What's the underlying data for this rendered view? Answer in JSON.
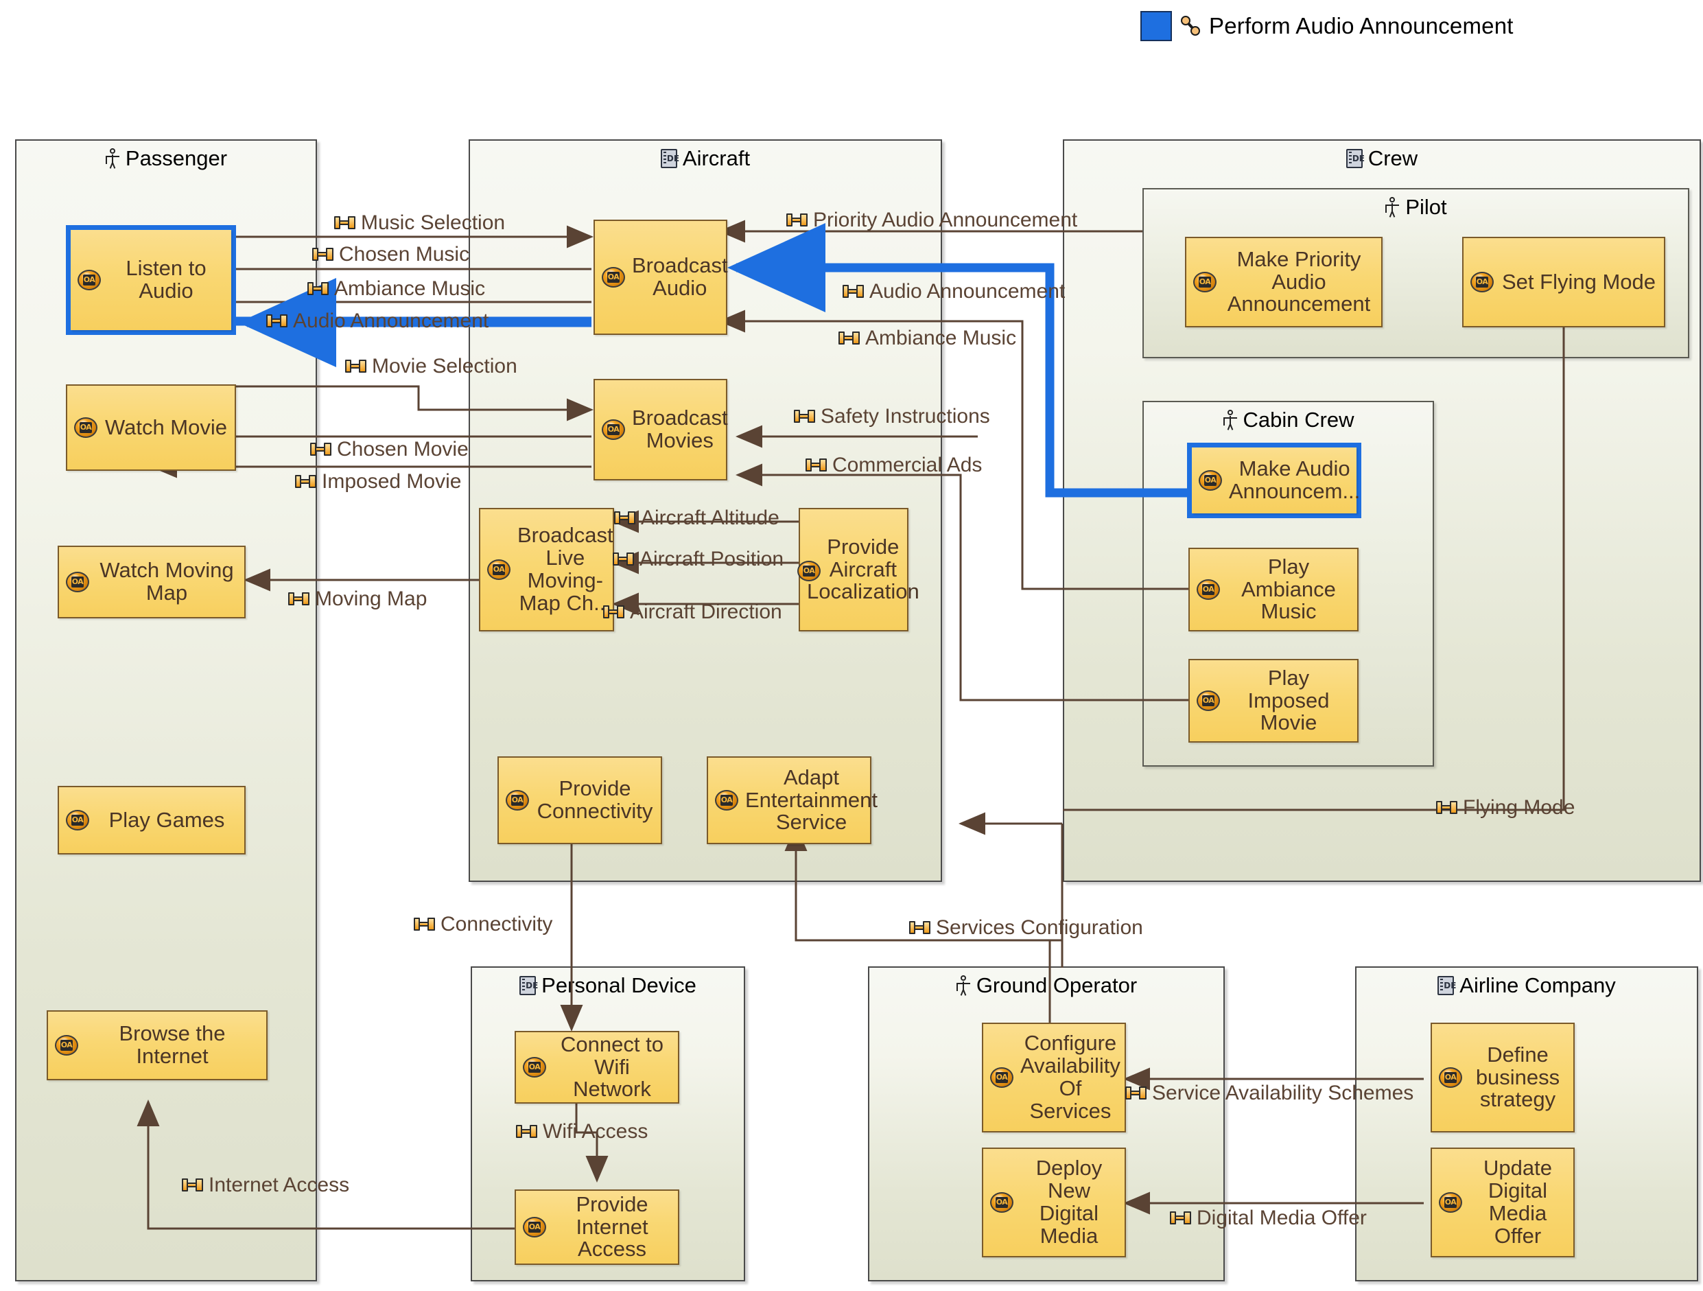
{
  "legend": {
    "label": "Perform Audio Announcement",
    "swatch_color": "#1E6FE0",
    "icon": "chain-link-icon"
  },
  "colors": {
    "highlight": "#1E6FE0",
    "activity_fill": "#F9D772",
    "activity_border": "#7a5a2a",
    "container_top": "#F7F8F3",
    "container_bottom": "#DEE0CC",
    "connector": "#5a4334",
    "text": "#4a3526"
  },
  "containers": [
    {
      "id": "passenger",
      "title": "Passenger",
      "icon": "actor-icon"
    },
    {
      "id": "aircraft",
      "title": "Aircraft",
      "icon": "block-icon"
    },
    {
      "id": "crew",
      "title": "Crew",
      "icon": "block-icon"
    },
    {
      "id": "pilot",
      "title": "Pilot",
      "icon": "actor-icon"
    },
    {
      "id": "cabin_crew",
      "title": "Cabin Crew",
      "icon": "actor-icon"
    },
    {
      "id": "personal_device",
      "title": "Personal Device",
      "icon": "block-icon"
    },
    {
      "id": "ground_operator",
      "title": "Ground Operator",
      "icon": "actor-icon"
    },
    {
      "id": "airline_company",
      "title": "Airline Company",
      "icon": "block-icon"
    }
  ],
  "activities": {
    "listen_to_audio": "Listen to Audio",
    "watch_movie": "Watch Movie",
    "watch_moving_map": "Watch Moving Map",
    "play_games": "Play Games",
    "browse_the_internet": "Browse the Internet",
    "broadcast_audio": "Broadcast Audio",
    "broadcast_movies": "Broadcast Movies",
    "broadcast_live_map": "Broadcast Live Moving-Map Ch...",
    "provide_aircraft_loc": "Provide Aircraft Localization",
    "provide_connectivity": "Provide Connectivity",
    "adapt_entertainment": "Adapt Entertainment Service",
    "make_priority_audio": "Make Priority Audio Announcement",
    "set_flying_mode": "Set Flying Mode",
    "make_audio_announce": "Make Audio Announcem...",
    "play_ambiance_music": "Play Ambiance Music",
    "play_imposed_movie": "Play Imposed Movie",
    "connect_to_wifi": "Connect to Wifi Network",
    "provide_internet": "Provide Internet Access",
    "configure_availability": "Configure Availability Of Services",
    "deploy_new_media": "Deploy New Digital Media",
    "define_business": "Define business strategy",
    "update_digital_media": "Update Digital Media Offer"
  },
  "selected_activities": [
    "listen_to_audio",
    "make_audio_announce"
  ],
  "flows": [
    {
      "id": "music_selection",
      "label": "Music Selection"
    },
    {
      "id": "chosen_music",
      "label": "Chosen Music"
    },
    {
      "id": "ambiance_music_left",
      "label": "Ambiance Music"
    },
    {
      "id": "audio_announcement_left",
      "label": "Audio Announcement"
    },
    {
      "id": "priority_audio",
      "label": "Priority Audio Announcement"
    },
    {
      "id": "audio_announcement_right",
      "label": "Audio Announcement"
    },
    {
      "id": "ambiance_music_right",
      "label": "Ambiance Music"
    },
    {
      "id": "movie_selection",
      "label": "Movie Selection"
    },
    {
      "id": "chosen_movie",
      "label": "Chosen Movie"
    },
    {
      "id": "imposed_movie",
      "label": "Imposed Movie"
    },
    {
      "id": "safety_instructions",
      "label": "Safety Instructions"
    },
    {
      "id": "commercial_ads",
      "label": "Commercial Ads"
    },
    {
      "id": "aircraft_altitude",
      "label": "Aircraft Altitude"
    },
    {
      "id": "aircraft_position",
      "label": "Aircraft Position"
    },
    {
      "id": "aircraft_direction",
      "label": "Aircraft Direction"
    },
    {
      "id": "moving_map",
      "label": "Moving Map"
    },
    {
      "id": "flying_mode",
      "label": "Flying Mode"
    },
    {
      "id": "connectivity",
      "label": "Connectivity"
    },
    {
      "id": "services_configuration",
      "label": "Services Configuration"
    },
    {
      "id": "wifi_access",
      "label": "Wifi Access"
    },
    {
      "id": "internet_access",
      "label": "Internet Access"
    },
    {
      "id": "service_availability",
      "label": "Service Availability Schemes"
    },
    {
      "id": "digital_media_offer",
      "label": "Digital Media Offer"
    }
  ]
}
